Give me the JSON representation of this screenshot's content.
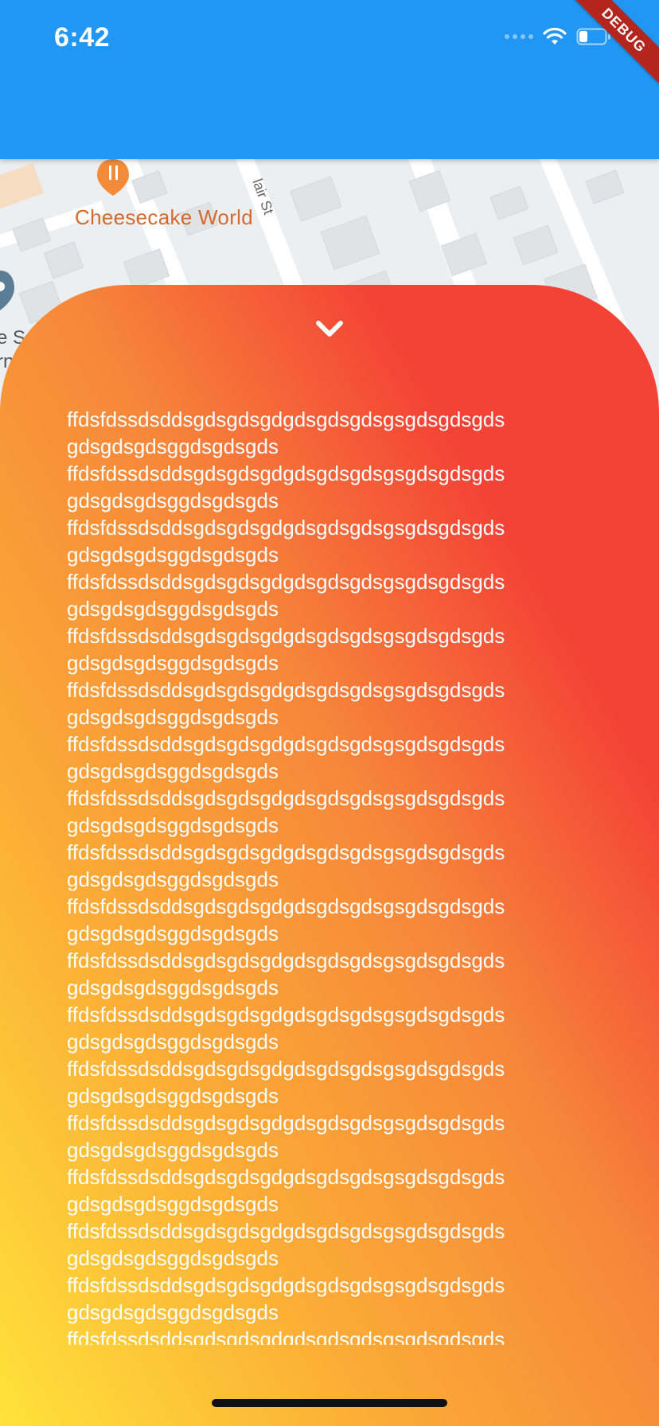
{
  "status_bar": {
    "time": "6:42"
  },
  "debug_banner": "DEBUG",
  "map": {
    "poi_name": "Cheesecake World",
    "street_name": "lair St",
    "partial_label_line1": "e S",
    "partial_label_line2": "rn"
  },
  "sheet": {
    "paragraphs": [
      "ffdsfdssdsddsgdsgdsgdgdsgdsgdsgsgdsgdsgds gdsgdsgdsggdsgdsgds",
      "ffdsfdssdsddsgdsgdsgdgdsgdsgdsgsgdsgdsgds gdsgdsgdsggdsgdsgds",
      "ffdsfdssdsddsgdsgdsgdgdsgdsgdsgsgdsgdsgds gdsgdsgdsggdsgdsgds",
      "ffdsfdssdsddsgdsgdsgdgdsgdsgdsgsgdsgdsgds gdsgdsgdsggdsgdsgds",
      "ffdsfdssdsddsgdsgdsgdgdsgdsgdsgsgdsgdsgds gdsgdsgdsggdsgdsgds",
      "ffdsfdssdsddsgdsgdsgdgdsgdsgdsgsgdsgdsgds gdsgdsgdsggdsgdsgds",
      "ffdsfdssdsddsgdsgdsgdgdsgdsgdsgsgdsgdsgds gdsgdsgdsggdsgdsgds",
      "ffdsfdssdsddsgdsgdsgdgdsgdsgdsgsgdsgdsgds gdsgdsgdsggdsgdsgds",
      "ffdsfdssdsddsgdsgdsgdgdsgdsgdsgsgdsgdsgds gdsgdsgdsggdsgdsgds",
      "ffdsfdssdsddsgdsgdsgdgdsgdsgdsgsgdsgdsgds gdsgdsgdsggdsgdsgds",
      "ffdsfdssdsddsgdsgdsgdgdsgdsgdsgsgdsgdsgds gdsgdsgdsggdsgdsgds",
      "ffdsfdssdsddsgdsgdsgdgdsgdsgdsgsgdsgdsgds gdsgdsgdsggdsgdsgds",
      "ffdsfdssdsddsgdsgdsgdgdsgdsgdsgsgdsgdsgds gdsgdsgdsggdsgdsgds",
      "ffdsfdssdsddsgdsgdsgdgdsgdsgdsgsgdsgdsgds gdsgdsgdsggdsgdsgds",
      "ffdsfdssdsddsgdsgdsgdgdsgdsgdsgsgdsgdsgds gdsgdsgdsggdsgdsgds",
      "ffdsfdssdsddsgdsgdsgdgdsgdsgdsgsgdsgdsgds gdsgdsgdsggdsgdsgds",
      "ffdsfdssdsddsgdsgdsgdgdsgdsgdsgsgdsgdsgds gdsgdsgdsggdsgdsgds",
      "ffdsfdssdsddsgdsgdsgdgdsgdsgdsgsgdsgdsgds gdsgdsgdsggdsgdsgds"
    ]
  },
  "colors": {
    "app_bar": "#2196F3",
    "sheet_gradient_start": "#FFE23A",
    "sheet_gradient_end": "#F44336",
    "sheet_text": "#FFFFFF",
    "poi_text": "#D46A2C"
  },
  "icons": {
    "collapse": "chevron-down-icon",
    "wifi": "wifi-icon",
    "battery": "battery-icon",
    "signal": "signal-icon",
    "poi": "restaurant-pin-icon",
    "partial_poi": "map-pin-icon"
  }
}
